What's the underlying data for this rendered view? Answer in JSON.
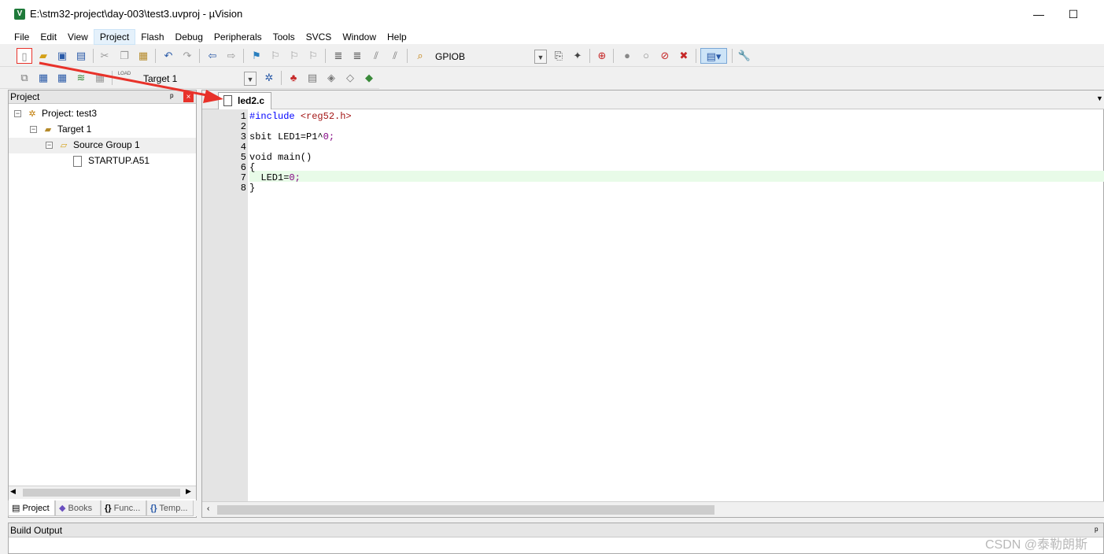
{
  "window": {
    "title": "E:\\stm32-project\\day-003\\test3.uvproj - µVision",
    "app_icon_label": "V",
    "minimize_glyph": "—",
    "maximize_glyph": "☐"
  },
  "menu": {
    "items": [
      "File",
      "Edit",
      "View",
      "Project",
      "Flash",
      "Debug",
      "Peripherals",
      "Tools",
      "SVCS",
      "Window",
      "Help"
    ],
    "active": "Project"
  },
  "toolbar": {
    "find_combo_value": "GPIOB",
    "target_combo_value": "Target 1",
    "load_label": "LOAD"
  },
  "project_panel": {
    "title": "Project",
    "pin_glyph": "ᵖ",
    "close_glyph": "×",
    "tree": {
      "project": "Project: test3",
      "target": "Target 1",
      "group": "Source Group 1",
      "file": "STARTUP.A51"
    },
    "tabs": [
      "Project",
      "Books",
      "Func...",
      "Temp..."
    ],
    "tab_icons": [
      "▤",
      "◆",
      "{}",
      "{}"
    ],
    "active_tab": "Project"
  },
  "editor": {
    "tab_label": "led2.c",
    "dropdown_glyph": "▼",
    "lines": [
      {
        "n": "1",
        "text": "#include <reg52.h>"
      },
      {
        "n": "2",
        "text": ""
      },
      {
        "n": "3",
        "text": "sbit LED1=P1^0;"
      },
      {
        "n": "4",
        "text": ""
      },
      {
        "n": "5",
        "text": "void main()"
      },
      {
        "n": "6",
        "text": "{"
      },
      {
        "n": "7",
        "text": "  LED1=0;"
      },
      {
        "n": "8",
        "text": "}"
      }
    ],
    "current_line": 7
  },
  "build_output": {
    "title": "Build Output",
    "pin_glyph": "ᵖ"
  },
  "watermark": "CSDN @泰勒朗斯",
  "colors": {
    "keyword_include": "#0000ff",
    "string_angle": "#a31515",
    "number": "#800080",
    "current_line_bg": "#e8fbe8",
    "annotation_red": "#e8322a"
  }
}
